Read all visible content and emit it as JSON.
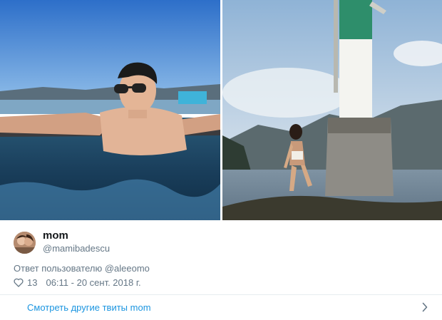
{
  "tweet": {
    "author": {
      "display_name": "mom",
      "handle": "@mamibadescu"
    },
    "reply_to": "Ответ пользователю @aleeomo",
    "likes": "13",
    "timestamp": "06:11 - 20 сент. 2018 г."
  },
  "footer": {
    "more_tweets": "Смотреть другие твиты mom"
  },
  "icons": {
    "like": "heart-outline-icon",
    "more": "chevron-right-icon"
  },
  "colors": {
    "link": "#1b95e0",
    "secondary_text": "#657786",
    "primary_text": "#14171a",
    "divider": "#e6ecf0"
  }
}
